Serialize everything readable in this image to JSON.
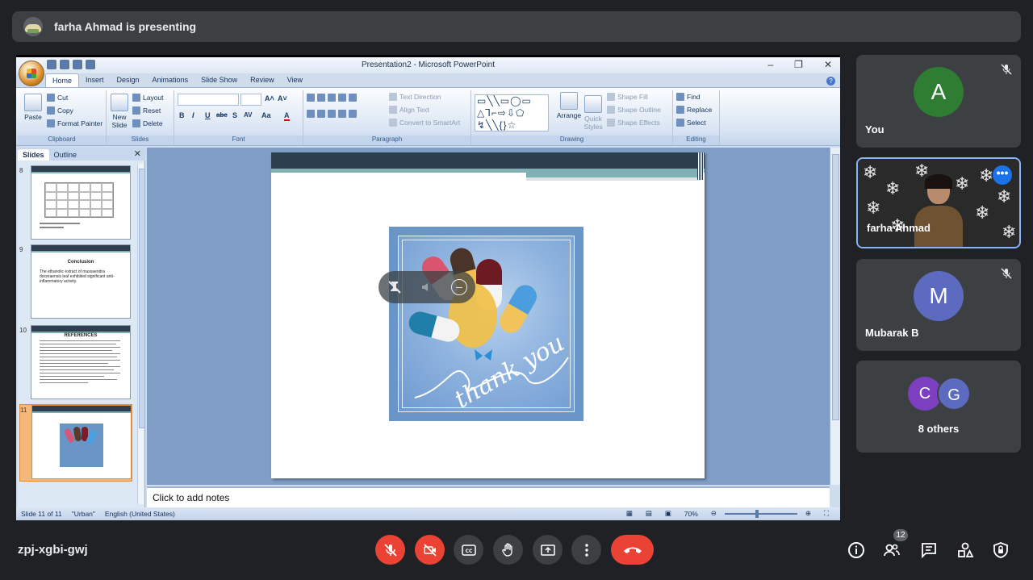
{
  "presenting": {
    "text": "farha Ahmad is presenting"
  },
  "ppt": {
    "window_title": "Presentation2 - Microsoft PowerPoint",
    "tabs": [
      "Home",
      "Insert",
      "Design",
      "Animations",
      "Slide Show",
      "Review",
      "View"
    ],
    "active_tab": "Home",
    "clipboard": {
      "paste": "Paste",
      "cut": "Cut",
      "copy": "Copy",
      "format_painter": "Format Painter",
      "label": "Clipboard"
    },
    "slides_group": {
      "new_slide": "New Slide",
      "layout": "Layout",
      "reset": "Reset",
      "delete": "Delete",
      "label": "Slides"
    },
    "font": {
      "label": "Font",
      "bold": "B",
      "italic": "I",
      "underline": "U",
      "strike": "abe",
      "shadow": "S",
      "spacing": "AV",
      "case": "Aa",
      "color": "A"
    },
    "paragraph": {
      "label": "Paragraph",
      "text_direction": "Text Direction",
      "align_text": "Align Text",
      "smartart": "Convert to SmartArt"
    },
    "drawing": {
      "label": "Drawing",
      "arrange": "Arrange",
      "quick_styles": "Quick Styles",
      "shape_fill": "Shape Fill",
      "shape_outline": "Shape Outline",
      "shape_effects": "Shape Effects"
    },
    "editing": {
      "label": "Editing",
      "find": "Find",
      "replace": "Replace",
      "select": "Select"
    },
    "pane_tabs": {
      "slides": "Slides",
      "outline": "Outline"
    },
    "thumbnails": [
      {
        "num": "8"
      },
      {
        "num": "9",
        "title": "Conclusion",
        "body": "The ethanolic extract of mussaendra doceraensis leaf exhibited significant anti-inflammatory activity."
      },
      {
        "num": "10",
        "title": "REFERENCES"
      },
      {
        "num": "11"
      }
    ],
    "notes_placeholder": "Click to add notes",
    "status": {
      "slide": "Slide 11 of 11",
      "theme": "\"Urban\"",
      "language": "English (United States)",
      "zoom": "70%"
    },
    "slide_caption": "thank you"
  },
  "participants": [
    {
      "name": "You",
      "initial": "A",
      "color": "#2e7d32",
      "muted": true
    },
    {
      "name": "farha Ahmad",
      "video": true
    },
    {
      "name": "Mubarak B",
      "initial": "M",
      "color": "#5c6bc0",
      "muted": true
    },
    {
      "name": "8 others",
      "initials": [
        "C",
        "G"
      ],
      "colors": [
        "#7b3fbf",
        "#5c6bc0"
      ]
    }
  ],
  "meeting": {
    "code": "zpj-xgbi-gwj",
    "participant_count": "12"
  },
  "colors": {
    "accent": "#1a73e8",
    "danger": "#ea4335",
    "bg": "#202124",
    "tile": "#3c4043"
  }
}
